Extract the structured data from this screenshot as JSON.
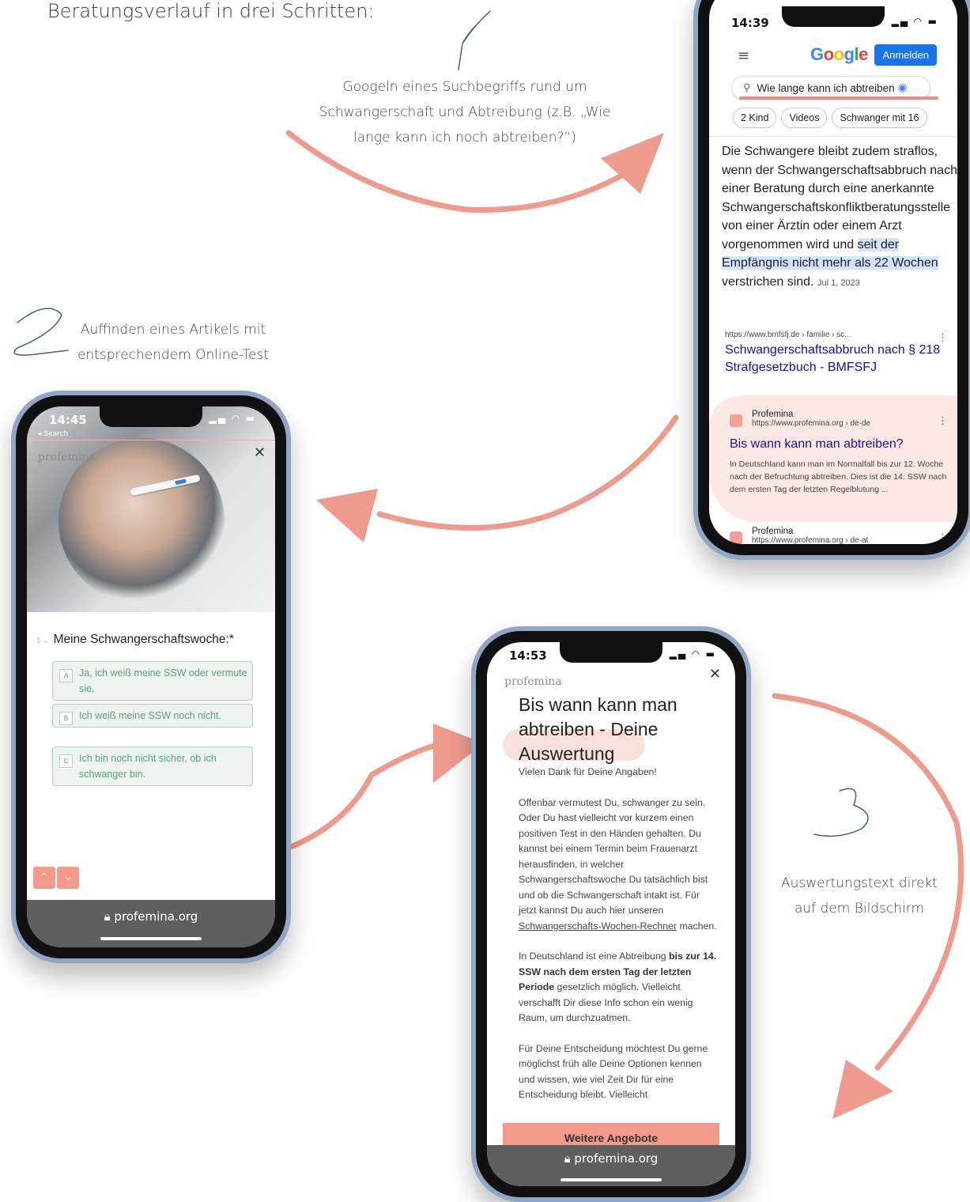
{
  "intro": {
    "heading": "Beratungsverlauf in drei Schritten:"
  },
  "steps": [
    {
      "digit": "1",
      "caption_lines": [
        "Googeln eines Suchbegriffs rund um",
        "Schwangerschaft und Abtreibung (z.B. „Wie",
        "lange kann ich noch abtreiben?“)"
      ]
    },
    {
      "digit": "2",
      "caption_lines": [
        "Auffinden eines Artikels mit",
        "entsprechendem Online-Test"
      ]
    },
    {
      "digit": "3",
      "caption_lines": [
        "Auswertungstext direkt",
        "auf dem Bildschirm"
      ]
    }
  ],
  "colors": {
    "accent": "#f39a8c",
    "handwriting": "#3f6b5a",
    "google_blue": "#1a73e8",
    "link": "#1a0dab",
    "quiz_green": "#5f9c79"
  },
  "phone_google": {
    "time": "14:39",
    "logo": "Google",
    "login_button": "Anmelden",
    "menu_icon": "hamburger-icon",
    "search_icon": "magnifier-icon",
    "search_query": "Wie lange kann ich abtreiben",
    "chips": [
      "2 Kind",
      "Videos",
      "Schwanger mit 16"
    ],
    "snippet_plain_1": "Die Schwangere bleibt zudem straflos, wenn der Schwangerschaftsabbruch nach einer Beratung durch eine anerkannte Schwangerschaftskonfliktberatungsstelle von einer Ärztin oder einem Arzt vorgenommen wird und ",
    "snippet_highlight": "seit der Empfängnis nicht mehr als 22 Wochen",
    "snippet_plain_2": " verstrichen sind.",
    "snippet_date": "Jul 1, 2023",
    "result1": {
      "url": "https://www.bmfsfj.de › familie › sc...",
      "title": "Schwangerschaftsabbruch nach § 218 Strafgesetzbuch - BMFSFJ"
    },
    "result2": {
      "site": "Profemina",
      "url": "https://www.profemina.org › de-de",
      "title": "Bis wann kann man abtreiben?",
      "description": "In Deutschland kann man im Normalfall bis zur 12. Woche nach der Befruchtung abtreiben. Dies ist die 14. SSW nach dem ersten Tag der letzten Regelblutung ..."
    },
    "result3": {
      "site": "Profemina",
      "url": "https://www.profemina.org › de-at"
    }
  },
  "phone_quiz": {
    "time": "14:45",
    "back_label": "◂ Search",
    "brand": "profemina",
    "question_number": "1→",
    "question": "Meine Schwangerschaftswoche:*",
    "options": [
      {
        "key": "A",
        "label": "Ja, ich weiß meine SSW oder vermute sie."
      },
      {
        "key": "B",
        "label": "Ich weiß meine SSW noch nicht."
      },
      {
        "key": "C",
        "label": "Ich bin noch nicht sicher, ob ich schwanger bin."
      }
    ],
    "url": "profemina.org"
  },
  "phone_result": {
    "time": "14:53",
    "brand": "profemina",
    "title_lines": [
      "Bis wann kann man",
      "abtreiben - Deine",
      "Auswertung"
    ],
    "thanks": "Vielen Dank für Deine Angaben!",
    "para1": "Offenbar vermutest Du, schwanger zu sein. Oder Du hast vielleicht vor kurzem einen positiven Test in den Händen gehalten. Du kannst bei einem Termin beim Frauenarzt herausfinden, in welcher Schwangerschaftswoche Du tatsächlich bist und ob die Schwangerschaft intakt ist. Für jetzt kannst Du auch hier unseren ",
    "para1_link": "Schwangerschafts-Wochen-Rechner",
    "para1_end": " machen.",
    "para2_start": "In Deutschland ist eine Abtreibung ",
    "para2_bold": "bis zur 14. SSW nach dem ersten Tag der letzten Periode",
    "para2_end": " gesetzlich möglich. Vielleicht verschafft Dir diese Info schon ein wenig Raum, um durchzuatmen.",
    "para3": "Für Deine Entscheidung möchtest Du gerne möglichst früh alle Deine Optionen kennen und wissen, wie viel Zeit Dir für eine Entscheidung bleibt. Vielleicht",
    "cta": "Weitere Angebote",
    "url": "profemina.org"
  }
}
